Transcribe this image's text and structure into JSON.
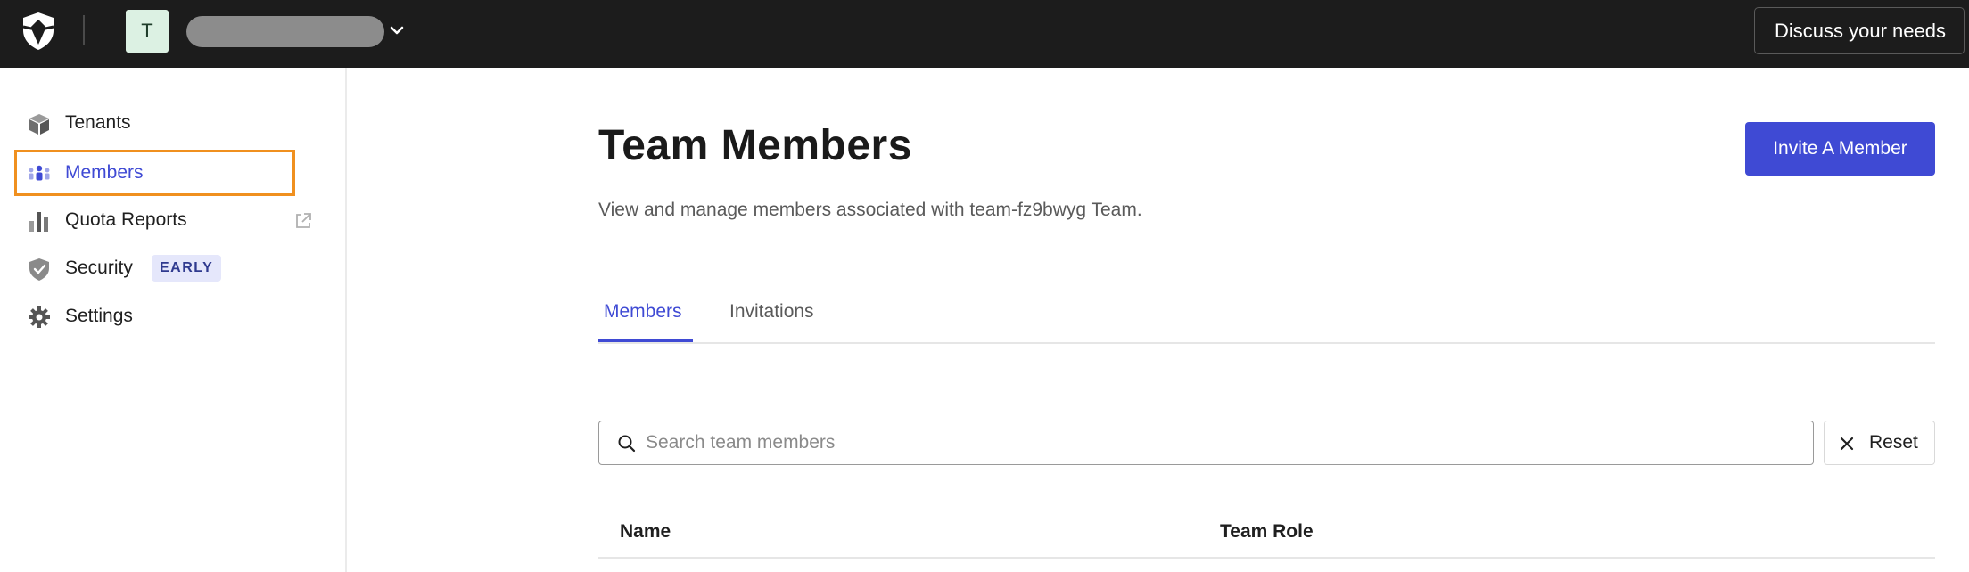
{
  "header": {
    "tenant_initial": "T",
    "discuss_label": "Discuss your needs"
  },
  "sidebar": {
    "items": [
      {
        "label": "Tenants",
        "icon": "cube-icon"
      },
      {
        "label": "Members",
        "icon": "members-icon",
        "active": true
      },
      {
        "label": "Quota Reports",
        "icon": "bar-chart-icon",
        "external": true
      },
      {
        "label": "Security",
        "icon": "shield-check-icon",
        "badge": "EARLY"
      },
      {
        "label": "Settings",
        "icon": "gear-icon"
      }
    ]
  },
  "main": {
    "title": "Team Members",
    "subtitle": "View and manage members associated with team-fz9bwyg Team.",
    "invite_label": "Invite A Member",
    "tabs": [
      {
        "label": "Members",
        "active": true
      },
      {
        "label": "Invitations",
        "active": false
      }
    ],
    "search": {
      "placeholder": "Search team members",
      "value": ""
    },
    "reset_label": "Reset",
    "table": {
      "columns": [
        "Name",
        "Team Role"
      ]
    }
  },
  "colors": {
    "accent": "#3f4ad4",
    "topbar": "#1c1c1c",
    "highlight": "#f0901f"
  }
}
